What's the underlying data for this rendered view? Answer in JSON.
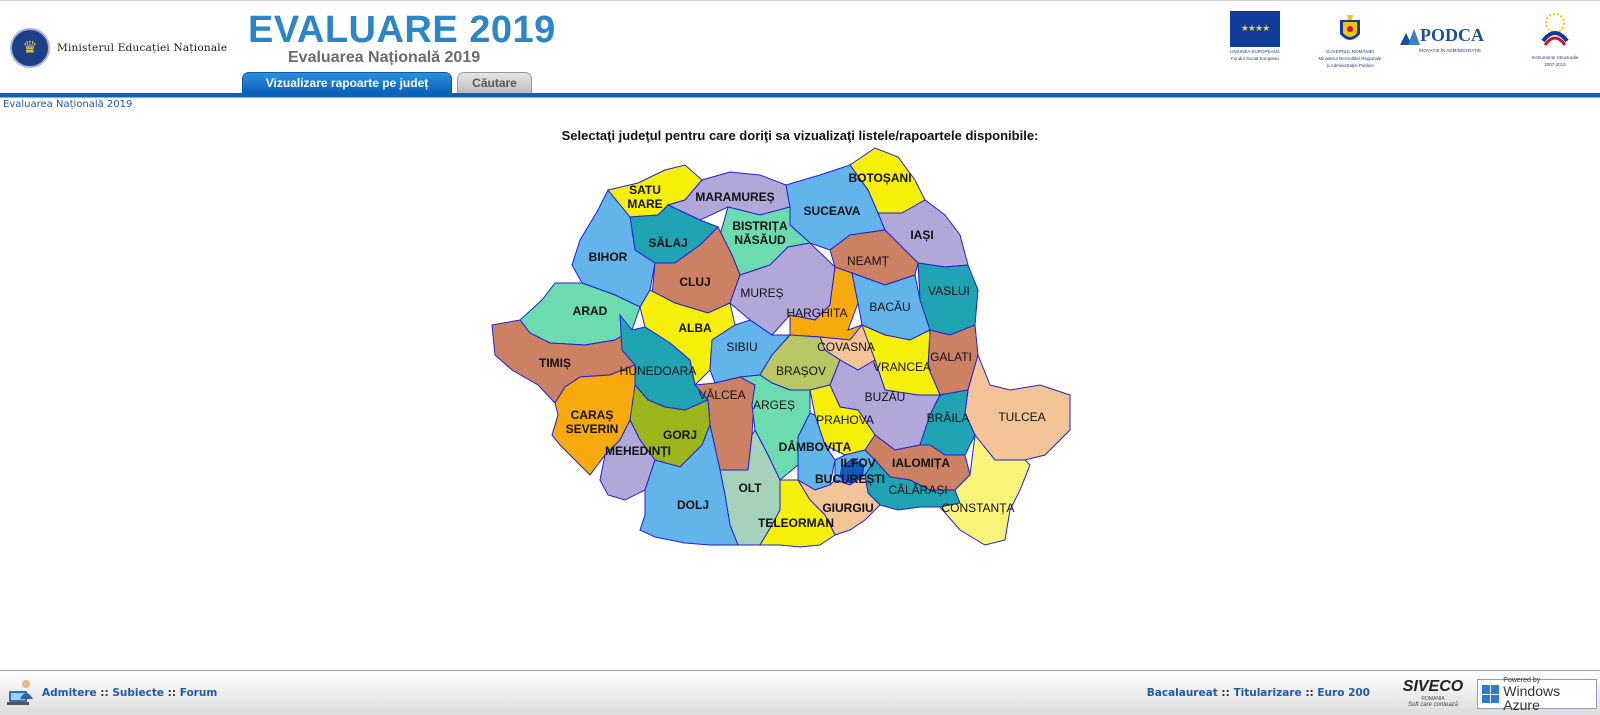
{
  "header": {
    "ministry_name": "Ministerul Educației Naționale",
    "app_title": "EVALUARE 2019",
    "app_subtitle": "Evaluarea Națională 2019",
    "tabs": [
      {
        "label": "Vizualizare rapoarte pe județ",
        "active": true
      },
      {
        "label": "Căutare",
        "active": false
      }
    ],
    "partners": [
      {
        "name": "eu-flag",
        "label1": "UNIUNEA EUROPEANĂ",
        "label2": "Fondul Social European"
      },
      {
        "name": "gov-crest",
        "label1": "GUVERNUL ROMÂNIEI",
        "label2": "Ministerul Dezvoltării Regionale",
        "label3": "și Administrației Publice"
      },
      {
        "name": "podca-logo",
        "label1": "PODCA",
        "label2": "INOVAȚIE ÎN ADMINISTRAȚIE"
      },
      {
        "name": "instrumente-structurale-logo",
        "label1": "Instrumente Structurale",
        "label2": "2007-2013"
      }
    ]
  },
  "breadcrumb": "Evaluarea Națională 2019",
  "instructions": "Selectaţi judeţul pentru care doriţi sa vizualizaţi listele/rapoartele disponibile:",
  "counties": [
    {
      "id": "satu-mare",
      "label": [
        "SATU",
        "MARE"
      ],
      "color": "#f5ef0a",
      "bold": true
    },
    {
      "id": "maramures",
      "label": [
        "MARAMUREȘ"
      ],
      "color": "#b1a7d8",
      "bold": true
    },
    {
      "id": "botosani",
      "label": [
        "BOTOȘANI"
      ],
      "color": "#f5ef0a",
      "bold": true
    },
    {
      "id": "suceava",
      "label": [
        "SUCEAVA"
      ],
      "color": "#62b4ea",
      "bold": true
    },
    {
      "id": "salaj",
      "label": [
        "SĂLAJ"
      ],
      "color": "#20a4b4",
      "bold": true
    },
    {
      "id": "bistrita-nasaud",
      "label": [
        "BISTRIȚA",
        "NĂSĂUD"
      ],
      "color": "#6cdcb0",
      "bold": true
    },
    {
      "id": "iasi",
      "label": [
        "IAȘI"
      ],
      "color": "#b1a7d8",
      "bold": true
    },
    {
      "id": "bihor",
      "label": [
        "BIHOR"
      ],
      "color": "#62b4ea",
      "bold": true
    },
    {
      "id": "cluj",
      "label": [
        "CLUJ"
      ],
      "color": "#cc8064",
      "bold": true
    },
    {
      "id": "neamt",
      "label": [
        "NEAMȚ"
      ],
      "color": "#cc8064",
      "bold": false
    },
    {
      "id": "mures",
      "label": [
        "MUREȘ"
      ],
      "color": "#b1a7d8",
      "bold": false
    },
    {
      "id": "vaslui",
      "label": [
        "VASLUI"
      ],
      "color": "#20a4b4",
      "bold": false
    },
    {
      "id": "arad",
      "label": [
        "ARAD"
      ],
      "color": "#6cdcb0",
      "bold": true
    },
    {
      "id": "harghita",
      "label": [
        "HARGHITA"
      ],
      "color": "#f8a90e",
      "bold": false
    },
    {
      "id": "bacau",
      "label": [
        "BACĂU"
      ],
      "color": "#62b4ea",
      "bold": false
    },
    {
      "id": "alba",
      "label": [
        "ALBA"
      ],
      "color": "#f5ef0a",
      "bold": true
    },
    {
      "id": "covasna",
      "label": [
        "COVASNA"
      ],
      "color": "#f3c498",
      "bold": false
    },
    {
      "id": "sibiu",
      "label": [
        "SIBIU"
      ],
      "color": "#62b4ea",
      "bold": false
    },
    {
      "id": "galati",
      "label": [
        "GALATI"
      ],
      "color": "#cc8064",
      "bold": false
    },
    {
      "id": "timis",
      "label": [
        "TIMIȘ"
      ],
      "color": "#cc8064",
      "bold": true
    },
    {
      "id": "vrancea",
      "label": [
        "VRANCEA"
      ],
      "color": "#f5ef0a",
      "bold": false
    },
    {
      "id": "hunedoara",
      "label": [
        "HUNEDOARA"
      ],
      "color": "#20a4b4",
      "bold": false
    },
    {
      "id": "brasov",
      "label": [
        "BRAȘOV"
      ],
      "color": "#b9c664",
      "bold": false
    },
    {
      "id": "valcea",
      "label": [
        "VÂLCEA"
      ],
      "color": "#cc8064",
      "bold": false
    },
    {
      "id": "buzau",
      "label": [
        "BUZĂU"
      ],
      "color": "#b1a7d8",
      "bold": false
    },
    {
      "id": "arges",
      "label": [
        "ARGEȘ"
      ],
      "color": "#6cdcb0",
      "bold": false
    },
    {
      "id": "tulcea",
      "label": [
        "TULCEA"
      ],
      "color": "#f3c498",
      "bold": false
    },
    {
      "id": "caras-severin",
      "label": [
        "CARAȘ",
        "SEVERIN"
      ],
      "color": "#f8a90e",
      "bold": true
    },
    {
      "id": "prahova",
      "label": [
        "PRAHOVA"
      ],
      "color": "#f5ef0a",
      "bold": false
    },
    {
      "id": "braila",
      "label": [
        "BRĂILA"
      ],
      "color": "#20a4b4",
      "bold": false
    },
    {
      "id": "gorj",
      "label": [
        "GORJ"
      ],
      "color": "#9db51c",
      "bold": true
    },
    {
      "id": "dambovita",
      "label": [
        "DÂMBOVIȚA"
      ],
      "color": "#62b4ea",
      "bold": true
    },
    {
      "id": "mehedinti",
      "label": [
        "MEHEDINȚI"
      ],
      "color": "#b1a7d8",
      "bold": true
    },
    {
      "id": "ilfov",
      "label": [
        "ILFOV"
      ],
      "color": "#62b4ea",
      "bold": true
    },
    {
      "id": "ialomita",
      "label": [
        "IALOMIȚA"
      ],
      "color": "#cc8064",
      "bold": true
    },
    {
      "id": "bucuresti",
      "label": [
        "BUCUREȘTI"
      ],
      "color": "#0c5bb6",
      "bold": true
    },
    {
      "id": "calarasi",
      "label": [
        "CĂLĂRAȘI"
      ],
      "color": "#20a4b4",
      "bold": false
    },
    {
      "id": "olt",
      "label": [
        "OLT"
      ],
      "color": "#a6d2bc",
      "bold": true
    },
    {
      "id": "dolj",
      "label": [
        "DOLJ"
      ],
      "color": "#62b4ea",
      "bold": true
    },
    {
      "id": "giurgiu",
      "label": [
        "GIURGIU"
      ],
      "color": "#f3c498",
      "bold": true
    },
    {
      "id": "constanta",
      "label": [
        "CONSTANȚA"
      ],
      "color": "#f8f47a",
      "bold": false
    },
    {
      "id": "teleorman",
      "label": [
        "TELEORMAN"
      ],
      "color": "#f5ef0a",
      "bold": true
    }
  ],
  "footer": {
    "left_links": [
      "Admitere",
      "Subiecte",
      "Forum"
    ],
    "right_links": [
      "Bacalaureat",
      "Titularizare",
      "Euro 200"
    ],
    "separator": "::",
    "siveco": {
      "name": "SIVECO",
      "sub": "ROMANIA",
      "tagline": "Soft care contează"
    },
    "azure": {
      "small": "Powered by",
      "big": "Windows Azure"
    }
  }
}
